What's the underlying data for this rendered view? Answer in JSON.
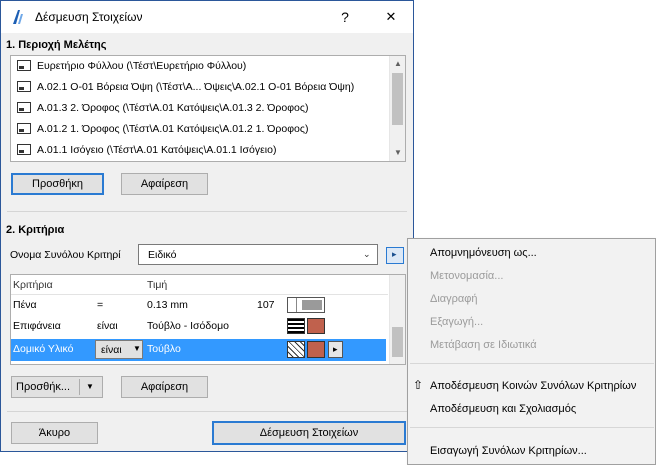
{
  "dialog": {
    "title": "Δέσμευση Στοιχείων",
    "help_glyph": "?",
    "close_glyph": "✕"
  },
  "study_area": {
    "heading": "1. Περιοχή Μελέτης",
    "items": [
      {
        "label": "Ευρετήριο Φύλλου (\\Τέστ\\Ευρετήριο Φύλλου)"
      },
      {
        "label": "A.02.1 Ο-01 Βόρεια Όψη (\\Τέστ\\A... Όψεις\\A.02.1 Ο-01 Βόρεια Όψη)"
      },
      {
        "label": "A.01.3 2. Όροφος (\\Τέστ\\A.01 Κατόψεις\\A.01.3 2. Όροφος)"
      },
      {
        "label": "A.01.2 1. Όροφος (\\Τέστ\\A.01 Κατόψεις\\A.01.2 1. Όροφος)"
      },
      {
        "label": "A.01.1 Ισόγειο (\\Τέστ\\A.01 Κατόψεις\\A.01.1 Ισόγειο)"
      }
    ],
    "add_label": "Προσθήκη",
    "remove_label": "Αφαίρεση"
  },
  "criteria": {
    "heading": "2. Κριτήρια",
    "set_name_label": "Ονομα Συνόλου Κριτηρί",
    "set_name_value": "Ειδικό",
    "col_criterion": "Κριτήρια",
    "col_value": "Τιμή",
    "rows": [
      {
        "criterion": "Πένα",
        "op": "=",
        "value": "0.13 mm",
        "extra": "107"
      },
      {
        "criterion": "Επιφάνεια",
        "op": "είναι",
        "value": "Τούβλο - Ισόδομο",
        "extra": ""
      },
      {
        "criterion": "Δομικό Υλικό",
        "op": "είναι",
        "value": "Τούβλο",
        "extra": ""
      }
    ],
    "add_label": "Προσθήκ...",
    "remove_label": "Αφαίρεση"
  },
  "footer": {
    "cancel_label": "Άκυρο",
    "ok_label": "Δέσμευση Στοιχείων"
  },
  "menu": {
    "items": [
      {
        "label": "Απομνημόνευση ως...",
        "enabled": true
      },
      {
        "label": "Μετονομασία...",
        "enabled": false
      },
      {
        "label": "Διαγραφή",
        "enabled": false
      },
      {
        "label": "Εξαγωγή...",
        "enabled": false
      },
      {
        "label": "Μετάβαση σε Ιδιωτικά",
        "enabled": false
      },
      {
        "label": "Αποδέσμευση Κοινών Συνόλων Κριτηρίων",
        "enabled": true
      },
      {
        "label": "Αποδέσμευση και Σχολιασμός",
        "enabled": true
      },
      {
        "label": "Εισαγωγή Συνόλων Κριτηρίων...",
        "enabled": true
      }
    ]
  },
  "colors": {
    "accent": "#2a7ad2",
    "selection": "#3399ff",
    "brick": "#c0614d"
  }
}
